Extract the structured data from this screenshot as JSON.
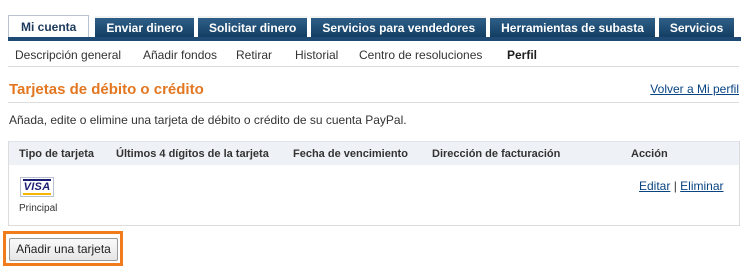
{
  "tabs": [
    {
      "label": "Mi cuenta",
      "active": true
    },
    {
      "label": "Enviar dinero",
      "active": false
    },
    {
      "label": "Solicitar dinero",
      "active": false
    },
    {
      "label": "Servicios para vendedores",
      "active": false
    },
    {
      "label": "Herramientas de subasta",
      "active": false
    },
    {
      "label": "Servicios",
      "active": false
    }
  ],
  "subnav": {
    "items": [
      {
        "label": "Descripción general"
      },
      {
        "label": "Añadir fondos"
      },
      {
        "label": "Retirar"
      },
      {
        "label": "Historial"
      },
      {
        "label": "Centro de resoluciones"
      },
      {
        "label": "Perfil",
        "current": true
      }
    ]
  },
  "page": {
    "title": "Tarjetas de débito o crédito",
    "back_link": "Volver a Mi perfil",
    "description": "Añada, edite o elimine una tarjeta de débito o crédito de su cuenta PayPal."
  },
  "table": {
    "headers": [
      "Tipo de tarjeta",
      "Últimos 4 dígitos de la tarjeta",
      "Fecha de vencimiento",
      "Dirección de facturación",
      "Acción"
    ],
    "rows": [
      {
        "card_brand": "VISA",
        "card_brand_icon": "visa-card-icon",
        "card_label": "Principal",
        "actions": {
          "edit": "Editar",
          "separator": "|",
          "delete": " Eliminar"
        }
      }
    ]
  },
  "add_card_button": "Añadir una tarjeta",
  "colors": {
    "title_orange": "#e37721",
    "tab_navy": "#1f4a73",
    "link_blue": "#084482",
    "highlight_orange": "#f07c1e"
  }
}
